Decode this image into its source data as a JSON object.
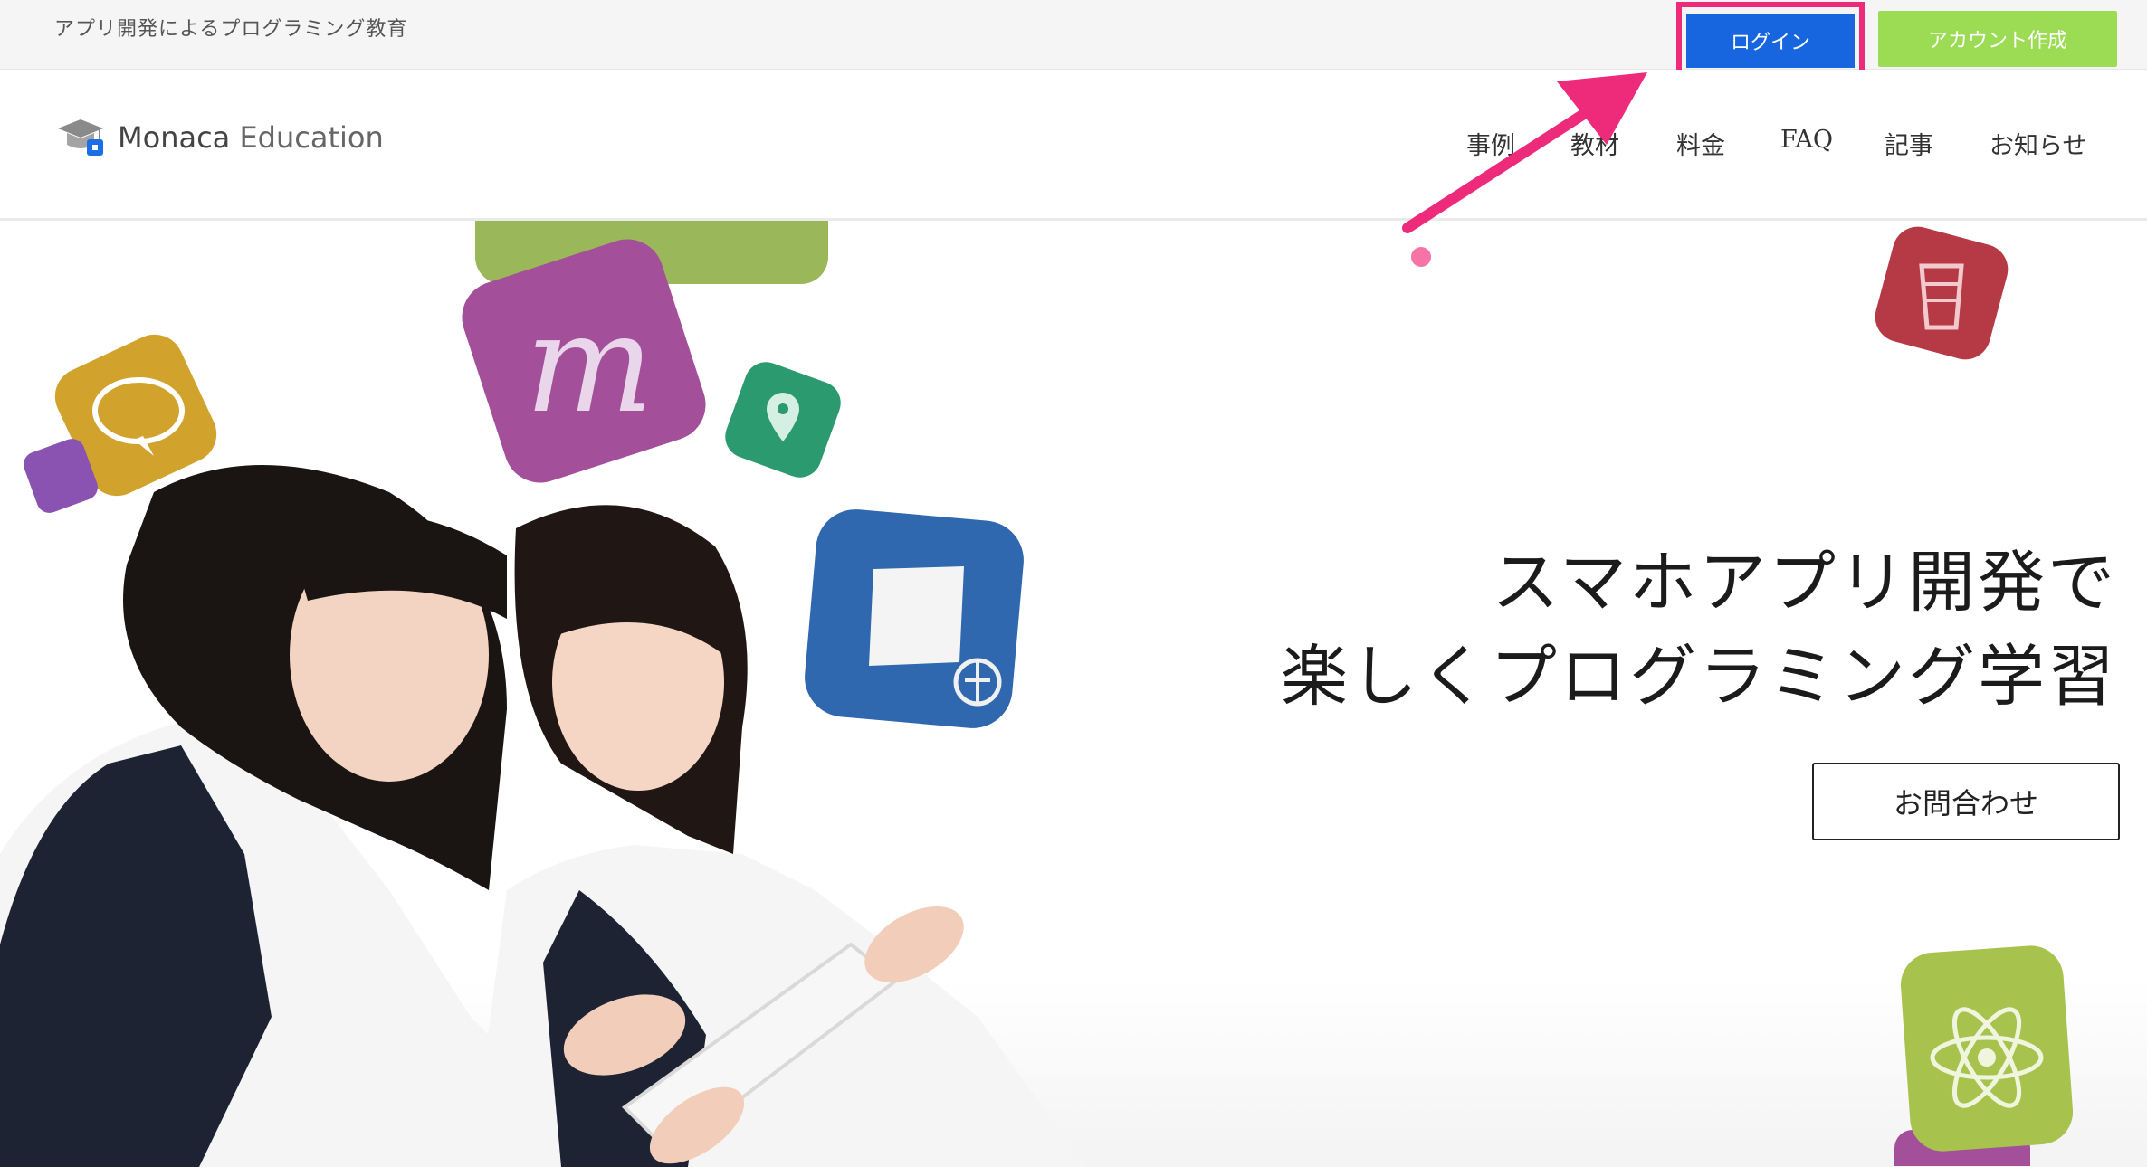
{
  "topbar": {
    "tagline": "アプリ開発によるプログラミング教育",
    "login_label": "ログイン",
    "signup_label": "アカウント作成"
  },
  "header": {
    "logo_brand": "Monaca",
    "logo_suffix": "Education",
    "nav": [
      {
        "label": "事例"
      },
      {
        "label": "教材"
      },
      {
        "label": "料金"
      },
      {
        "label": "FAQ"
      },
      {
        "label": "記事"
      },
      {
        "label": "お知らせ"
      }
    ]
  },
  "hero": {
    "title_line1": "スマホアプリ開発で",
    "title_line2": "楽しくプログラミング学習",
    "contact_label": "お問合わせ"
  },
  "colors": {
    "login": "#1766e0",
    "signup": "#9cdc55",
    "highlight": "#ee2a7b"
  }
}
